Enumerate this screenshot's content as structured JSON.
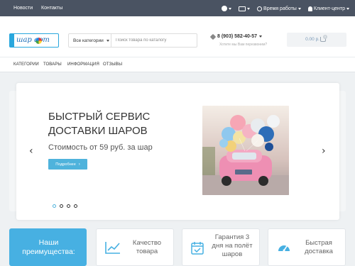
{
  "topbar": {
    "links": [
      "Новости",
      "Контакты"
    ],
    "hours_label": "Время работы",
    "client_center_label": "Клиент-центр"
  },
  "header": {
    "logo_text": "шар  арт",
    "search": {
      "category_label": "Все категории",
      "placeholder": "Поиск товара по каталогу"
    },
    "phone": "8 (903) 582-40-57",
    "callback": "Хотите мы Вам перезвоним?",
    "cart_sum": "0.00 р.",
    "cart_count": "0"
  },
  "nav": {
    "items": [
      "КАТЕГОРИИ",
      "ТОВАРЫ",
      "ИНФОРМАЦИЯ",
      "ОТЗЫВЫ"
    ]
  },
  "slider": {
    "title_line1": "БЫСТРЫЙ СЕРВИС",
    "title_line2": "ДОСТАВКИ ШАРОВ",
    "subtitle": "Стоимость от 59 руб. за шар",
    "button_label": "Подробнее",
    "dots": 4,
    "active_dot": 0
  },
  "features": {
    "heading_line1": "Наши",
    "heading_line2": "преимущества:",
    "quality_line1": "Качество",
    "quality_line2": "товара",
    "guarantee_line1": "Гарантия 3",
    "guarantee_line2": "дня на полёт",
    "guarantee_line3": "шаров",
    "fast_line1": "Быстрая",
    "fast_line2": "доставка"
  },
  "colors": {
    "topbar": "#4a5362",
    "accent": "#47b0e2",
    "logo": "#1f6fb8"
  }
}
